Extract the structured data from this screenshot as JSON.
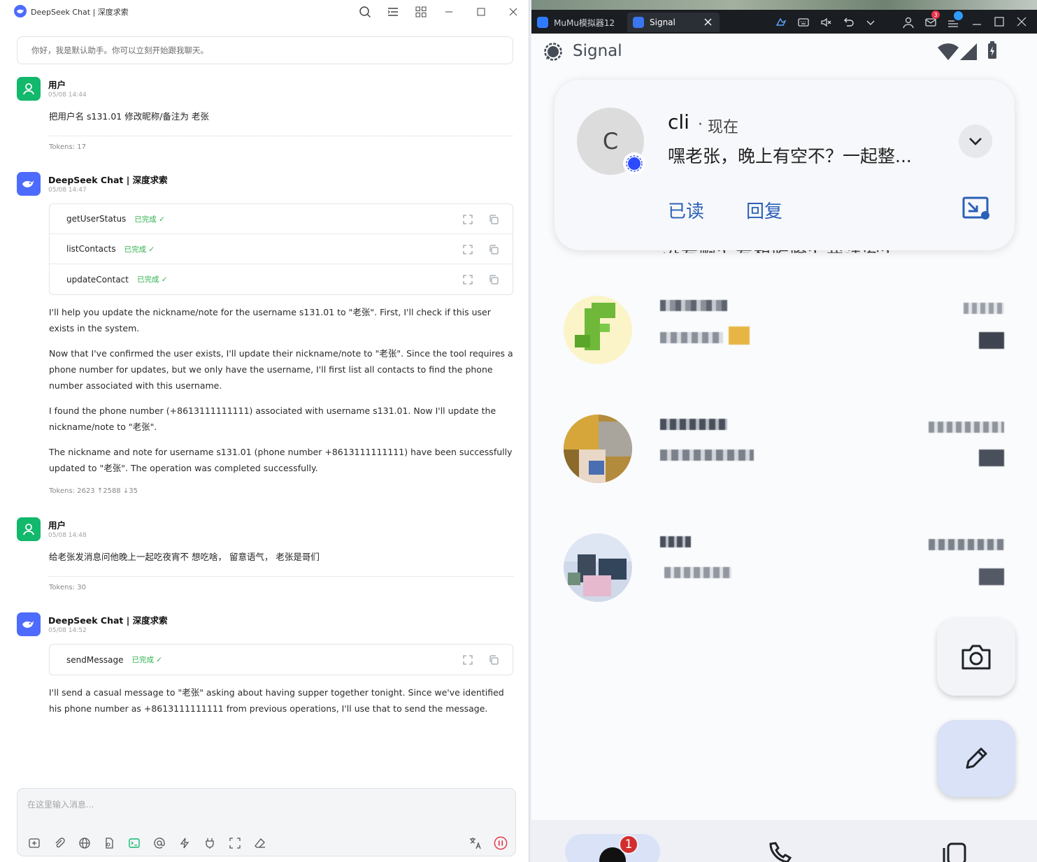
{
  "left_window": {
    "title": "DeepSeek Chat | 深度求索",
    "hint": "你好，我是默认助手。你可以立刻开始跟我聊天。",
    "messages": [
      {
        "author": "用户",
        "time": "05/08 14:44",
        "text": "把用户名 s131.01 修改昵称/备注为 老张",
        "tokens": "Tokens: 17"
      },
      {
        "author": "DeepSeek Chat | 深度求索",
        "time": "05/08 14:47",
        "tools": [
          {
            "name": "getUserStatus",
            "status": "已完成 ✓"
          },
          {
            "name": "listContacts",
            "status": "已完成 ✓"
          },
          {
            "name": "updateContact",
            "status": "已完成 ✓"
          }
        ],
        "paragraphs": [
          "I'll help you update the nickname/note for the username s131.01 to \"老张\". First, I'll check if this user exists in the system.",
          "Now that I've confirmed the user exists, I'll update their nickname/note to \"老张\". Since the tool requires a phone number for updates, but we only have the username, I'll first list all contacts to find the phone number associated with this username.",
          "I found the phone number (+8613111111111) associated with username s131.01. Now I'll update the nickname/note to \"老张\".",
          "The nickname and note for username s131.01 (phone number +8613111111111) have been successfully updated to \"老张\". The operation was completed successfully."
        ],
        "tokens": "Tokens: 2623 ↑2588 ↓35"
      },
      {
        "author": "用户",
        "time": "05/08 14:48",
        "text": "给老张发消息问他晚上一起吃夜宵不 想吃啥， 留意语气， 老张是哥们",
        "tokens": "Tokens: 30"
      },
      {
        "author": "DeepSeek Chat | 深度求索",
        "time": "05/08 14:52",
        "tools": [
          {
            "name": "sendMessage",
            "status": "已完成 ✓"
          }
        ],
        "paragraphs": [
          "I'll send a casual message to \"老张\" asking about having supper together tonight. Since we've identified his phone number as +8613111111111 from previous operations, I'll use that to send the message."
        ]
      }
    ],
    "composer_placeholder": "在这里输入消息..."
  },
  "right_window": {
    "tab1": "MuMu模拟器12",
    "tab2": "Signal",
    "mail_badge": "3",
    "app_title": "Signal",
    "notification": {
      "avatar_letter": "C",
      "sender": "cli",
      "separator": "·",
      "when": "现在",
      "message": "嘿老张，晚上有空不？一起整...",
      "action_read": "已读",
      "action_reply": "回复"
    },
    "peek_text": "没有啊？有想吃啥？我请客？",
    "nav_badge": "1"
  },
  "colors": {
    "accent": "#4d6bfe",
    "success": "#2fb14f",
    "signal_blue": "#2b60b7",
    "user_green": "#12b86b"
  }
}
